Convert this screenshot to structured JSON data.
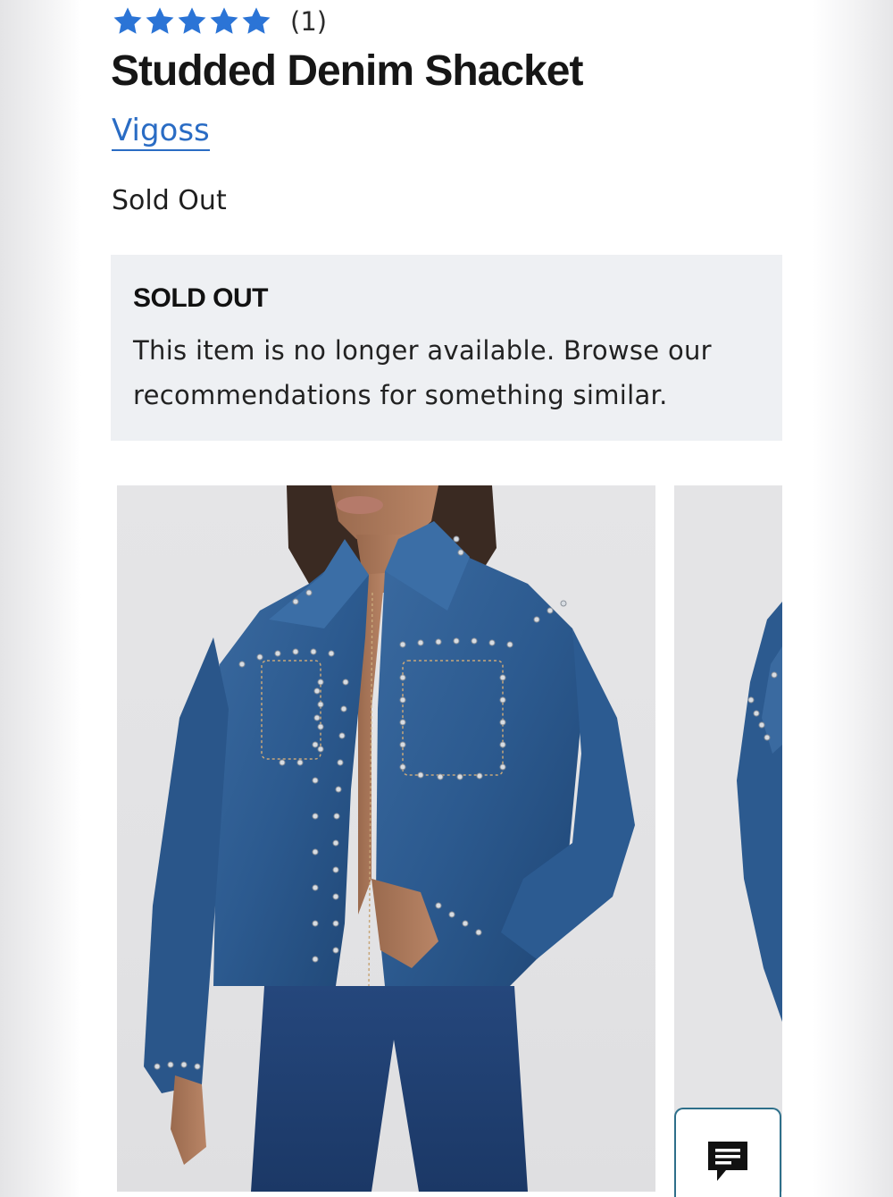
{
  "product": {
    "rating_stars": 5,
    "review_count": "(1)",
    "title": "Studded Denim Shacket",
    "brand": "Vigoss",
    "price_status": "Sold Out"
  },
  "notice": {
    "title": "SOLD OUT",
    "body": "This item is no longer available. Browse our recommendations for something similar."
  },
  "gallery": {
    "images": [
      {
        "icon": "product-photo-model-front"
      },
      {
        "icon": "product-photo-model-side"
      }
    ]
  },
  "chat": {
    "icon": "chat-bubble-icon"
  },
  "colors": {
    "star": "#2b74d6",
    "link": "#2a6cc4",
    "notice_bg": "#eef0f3",
    "denim": "#2d5a8e",
    "chat_border": "#2e6f8a"
  }
}
